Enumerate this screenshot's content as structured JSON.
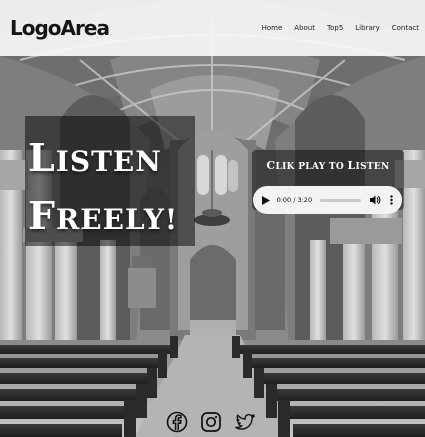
{
  "header": {
    "logo": "LogoArea",
    "nav": [
      "Home",
      "About",
      "Top5",
      "Library",
      "Contact"
    ]
  },
  "hero": {
    "line1": "Listen",
    "line2": "Freely!"
  },
  "player": {
    "caption": "Clik play to Listen",
    "time": "0:00 / 3:20",
    "progress": 0
  },
  "social": {
    "icons": [
      "facebook-icon",
      "instagram-icon",
      "twitter-icon"
    ]
  },
  "colors": {
    "header_bg": "#f8f8f8",
    "text_dark": "#161616",
    "hero_text": "#ffffff",
    "player_bg": "#f1f3f4"
  }
}
